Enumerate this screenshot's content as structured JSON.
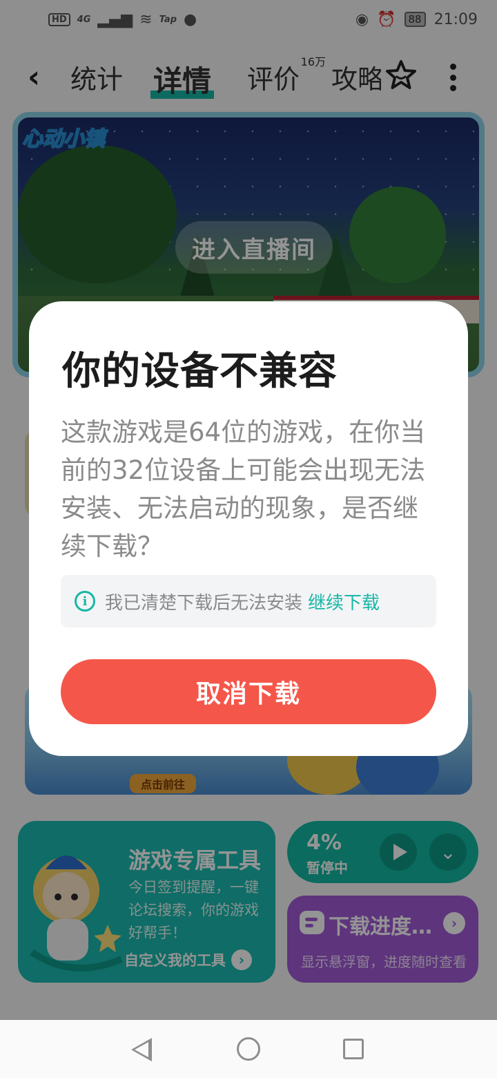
{
  "status_bar": {
    "left_badges": [
      "HD",
      "4G",
      "Tap"
    ],
    "battery": "88",
    "time": "21:09"
  },
  "nav": {
    "back_icon": "chevron-left-icon",
    "tabs": [
      {
        "label": "统计",
        "active": false
      },
      {
        "label": "详情",
        "active": true
      },
      {
        "label": "评价",
        "count": "16万",
        "active": false
      },
      {
        "label": "攻略",
        "active": false
      }
    ],
    "accent_color": "#16b7a6"
  },
  "hero": {
    "logo_text": "心动小镇",
    "live_button": "进入直播间"
  },
  "background_banner": {
    "go_label": "点击前往"
  },
  "tools_card": {
    "title": "游戏专属工具",
    "description": "今日签到提醒，一键论坛搜索，你的游戏好帮手！",
    "cta": "自定义我的工具"
  },
  "download_card": {
    "percent": "4%",
    "state": "暂停中",
    "progress_fraction": 0.04
  },
  "float_card": {
    "title": "下载进度悬浮窗",
    "description": "显示悬浮窗，进度随时查看"
  },
  "dialog": {
    "title": "你的设备不兼容",
    "body": "这款游戏是64位的游戏，在你当前的32位设备上可能会出现无法安装、无法启动的现象，是否继续下载？",
    "ack_text": "我已清楚下载后无法安装",
    "continue_link": "继续下载",
    "cancel_button": "取消下载",
    "cancel_color": "#f4574a"
  }
}
